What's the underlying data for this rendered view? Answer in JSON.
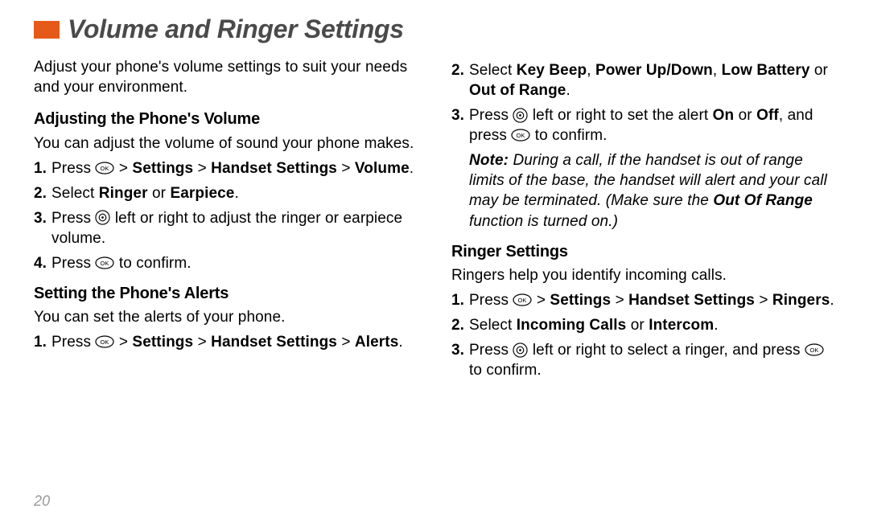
{
  "title": "Volume and Ringer Settings",
  "intro": "Adjust your phone's volume settings to suit your needs and your environment.",
  "sections": {
    "adjust": {
      "heading": "Adjusting the Phone's Volume",
      "desc": "You can adjust the volume of sound your phone makes.",
      "steps": {
        "s1a": "Press ",
        "s1b": " > ",
        "s1c": "Settings",
        "s1d": " > ",
        "s1e": "Handset Settings",
        "s1f": " > ",
        "s1g": "Volume",
        "s1h": ".",
        "s2a": "Select ",
        "s2b": "Ringer",
        "s2c": " or ",
        "s2d": "Earpiece",
        "s2e": ".",
        "s3a": "Press ",
        "s3b": " left or right to adjust the ringer or earpiece volume.",
        "s4a": "Press ",
        "s4b": " to confirm."
      }
    },
    "alerts": {
      "heading": "Setting the Phone's Alerts",
      "desc": "You can set the alerts of your phone.",
      "steps": {
        "s1a": "Press ",
        "s1b": " > ",
        "s1c": "Settings",
        "s1d": " > ",
        "s1e": "Handset Settings",
        "s1f": " > ",
        "s1g": "Alerts",
        "s1h": ".",
        "s2a": "Select ",
        "s2b": "Key Beep",
        "s2c": ", ",
        "s2d": "Power Up/Down",
        "s2e": ", ",
        "s2f": "Low Battery",
        "s2g": " or ",
        "s2h": "Out of Range",
        "s2i": ".",
        "s3a": "Press ",
        "s3b": " left or right to set the alert ",
        "s3c": "On",
        "s3d": " or ",
        "s3e": "Off",
        "s3f": ", and press ",
        "s3g": " to confirm."
      },
      "note_label": "Note:",
      "note_body": " During a call, if the handset is out of range limits of the base, the handset will alert and your call may be terminated. (Make sure the ",
      "note_bold": "Out Of Range",
      "note_tail": " function is turned on.)"
    },
    "ringers": {
      "heading": "Ringer Settings",
      "desc": "Ringers help you identify incoming calls.",
      "steps": {
        "s1a": "Press ",
        "s1b": " > ",
        "s1c": "Settings",
        "s1d": " > ",
        "s1e": "Handset Settings",
        "s1f": " > ",
        "s1g": "Ringers",
        "s1h": ".",
        "s2a": "Select ",
        "s2b": "Incoming Calls",
        "s2c": " or ",
        "s2d": "Intercom",
        "s2e": ".",
        "s3a": "Press ",
        "s3b": " left or right to select a ringer, and press ",
        "s3c": " to confirm."
      }
    }
  },
  "page_number": "20"
}
